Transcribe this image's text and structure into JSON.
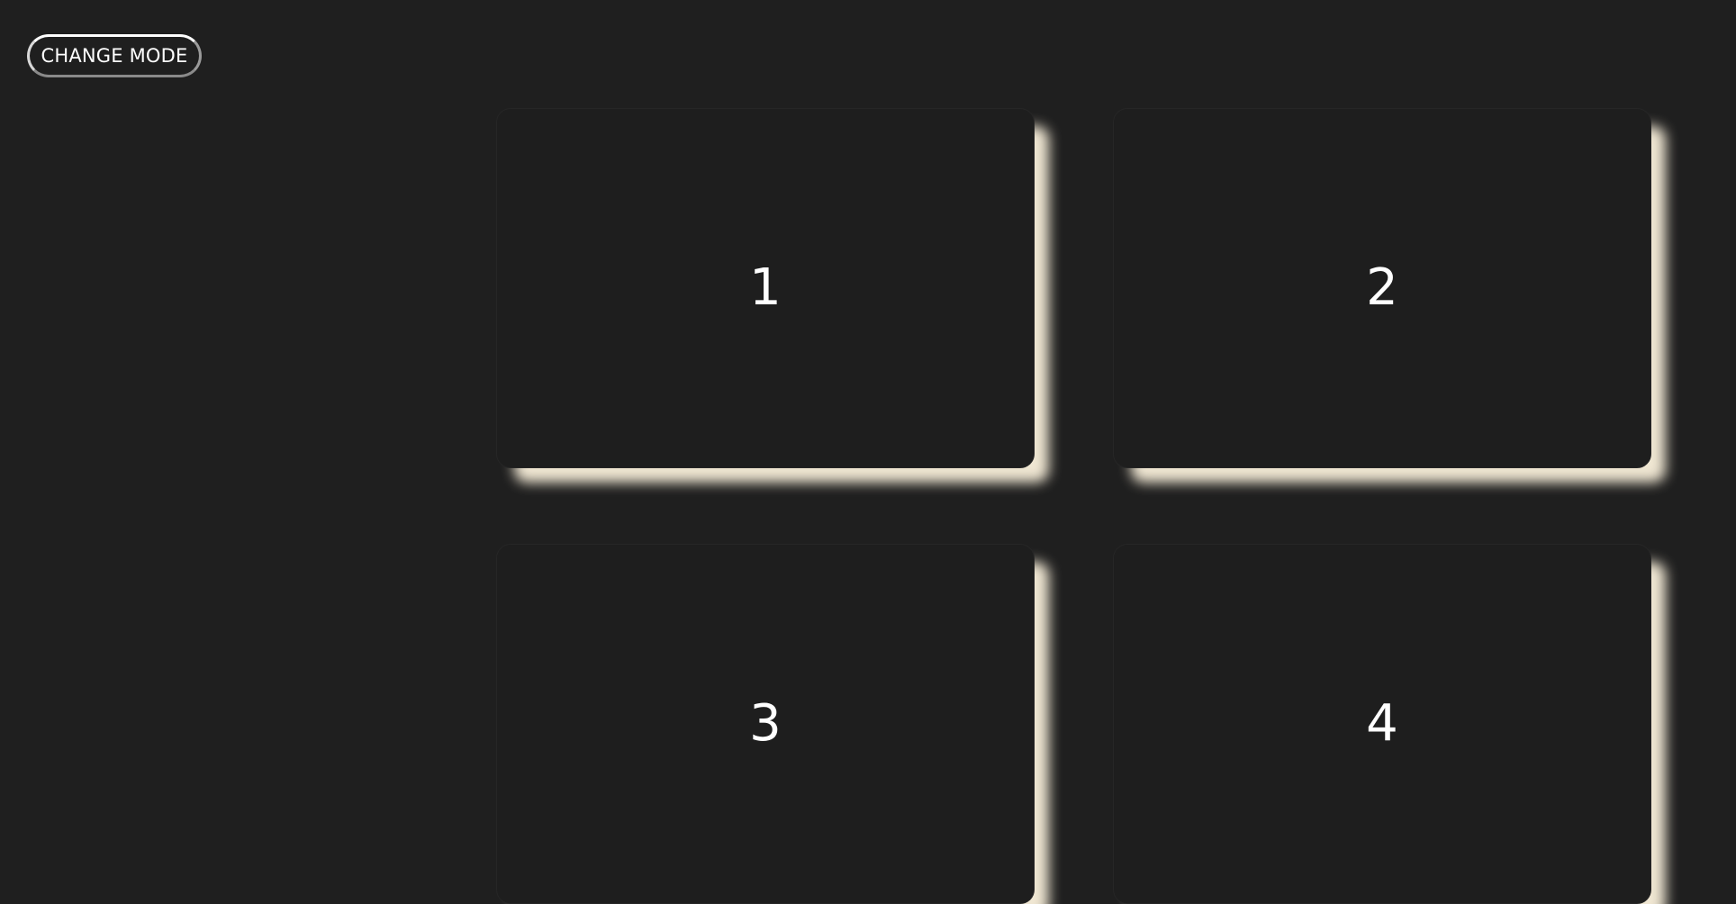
{
  "toolbar": {
    "mode_button_label": "CHANGE MODE"
  },
  "cards": [
    {
      "label": "1"
    },
    {
      "label": "2"
    },
    {
      "label": "3"
    },
    {
      "label": "4"
    }
  ],
  "theme": {
    "background": "#1f1f1f",
    "card_background": "#1e1e1e",
    "card_shadow": "#efe6d2",
    "text": "#ffffff"
  }
}
